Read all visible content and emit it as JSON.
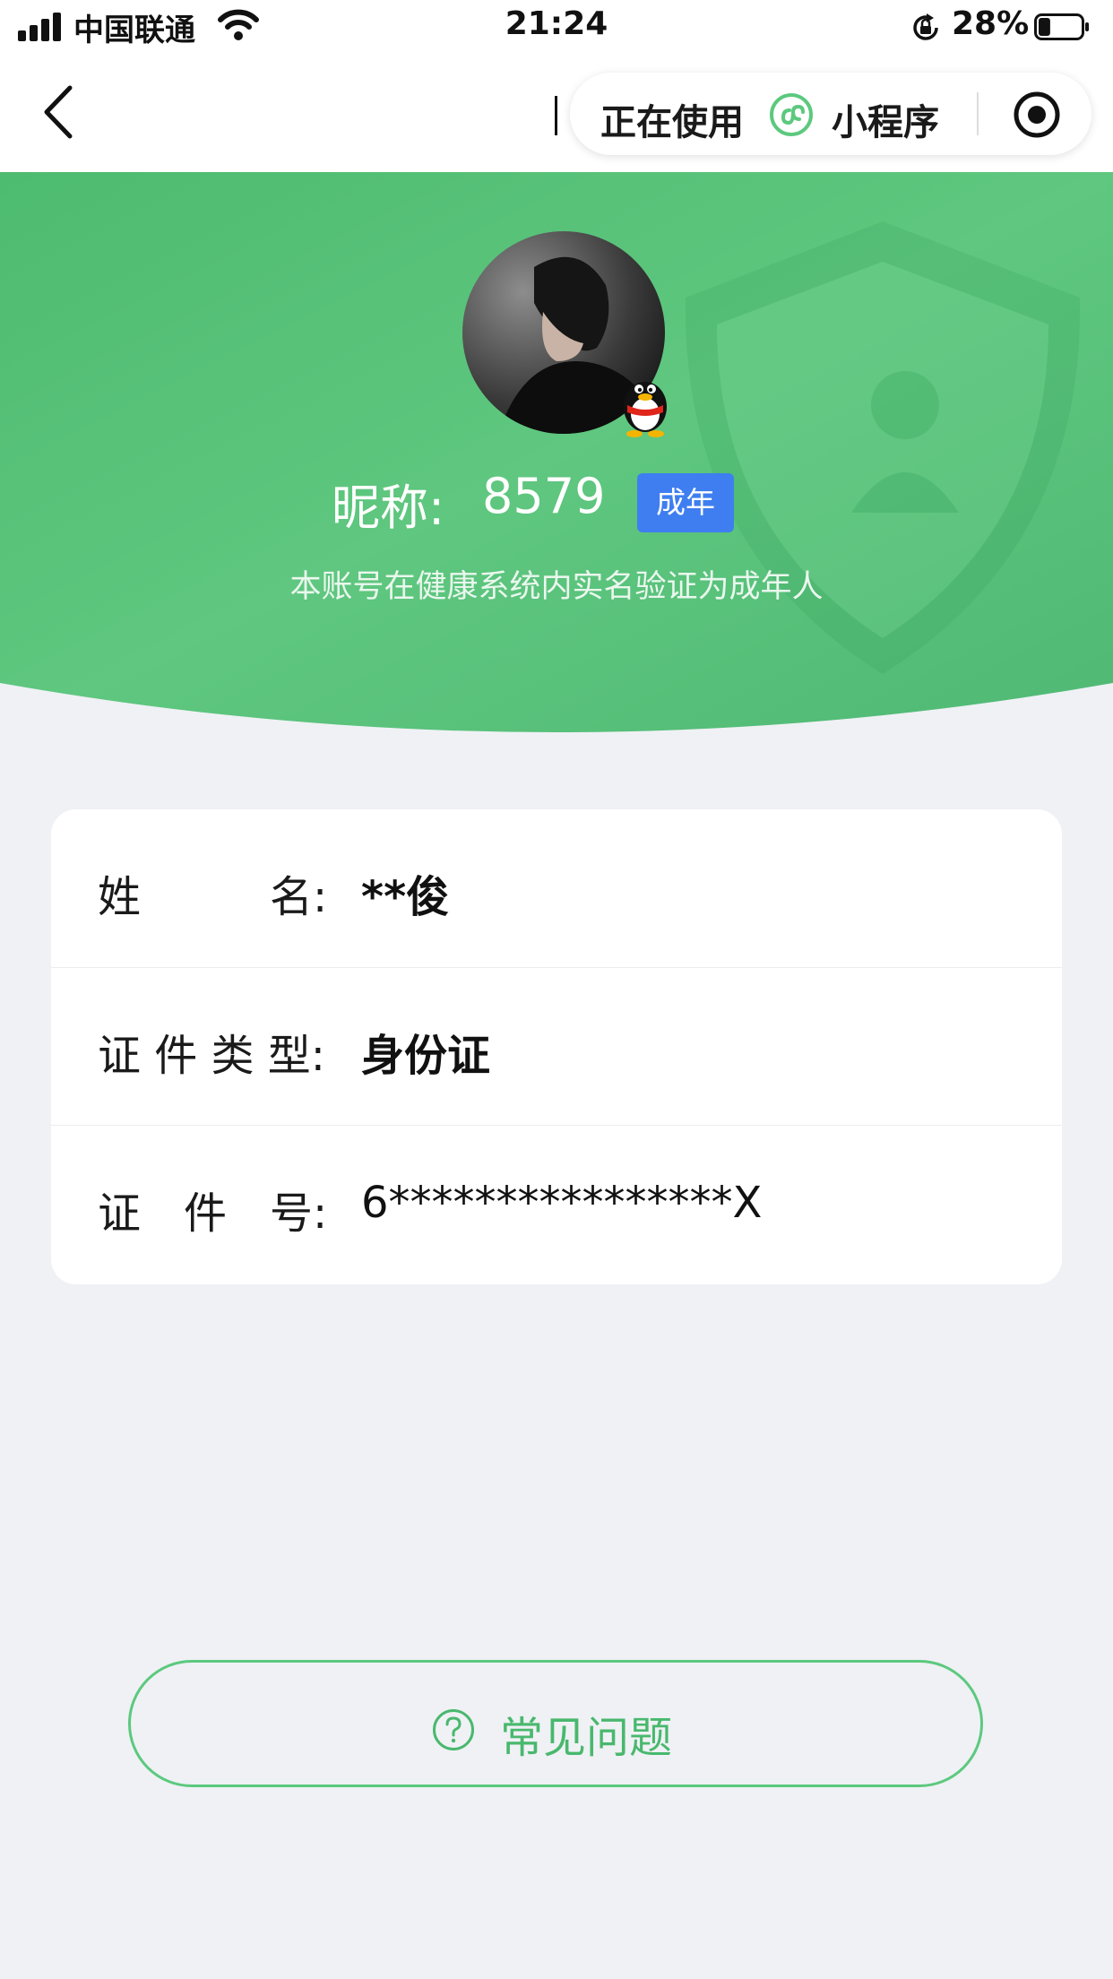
{
  "status_bar": {
    "carrier": "中国联通",
    "time": "21:24",
    "battery_percent": "28%",
    "battery_level": 0.28
  },
  "nav": {
    "capsule_using": "正在使用",
    "capsule_mini": "小程序"
  },
  "header": {
    "nickname_label": "昵称:",
    "nickname": "8579",
    "badge": "成年",
    "note": "本账号在健康系统内实名验证为成年人"
  },
  "info": {
    "rows": [
      {
        "label": "姓　　　名:",
        "value": "**俊"
      },
      {
        "label": "证 件 类 型:",
        "value": "身份证"
      },
      {
        "label": "证　件　号:",
        "value": "6****************X"
      }
    ]
  },
  "faq": {
    "label": "常见问题"
  },
  "colors": {
    "brand_green": "#5cc97e",
    "badge_blue": "#3f7ef0",
    "page_bg": "#eff1f5"
  }
}
